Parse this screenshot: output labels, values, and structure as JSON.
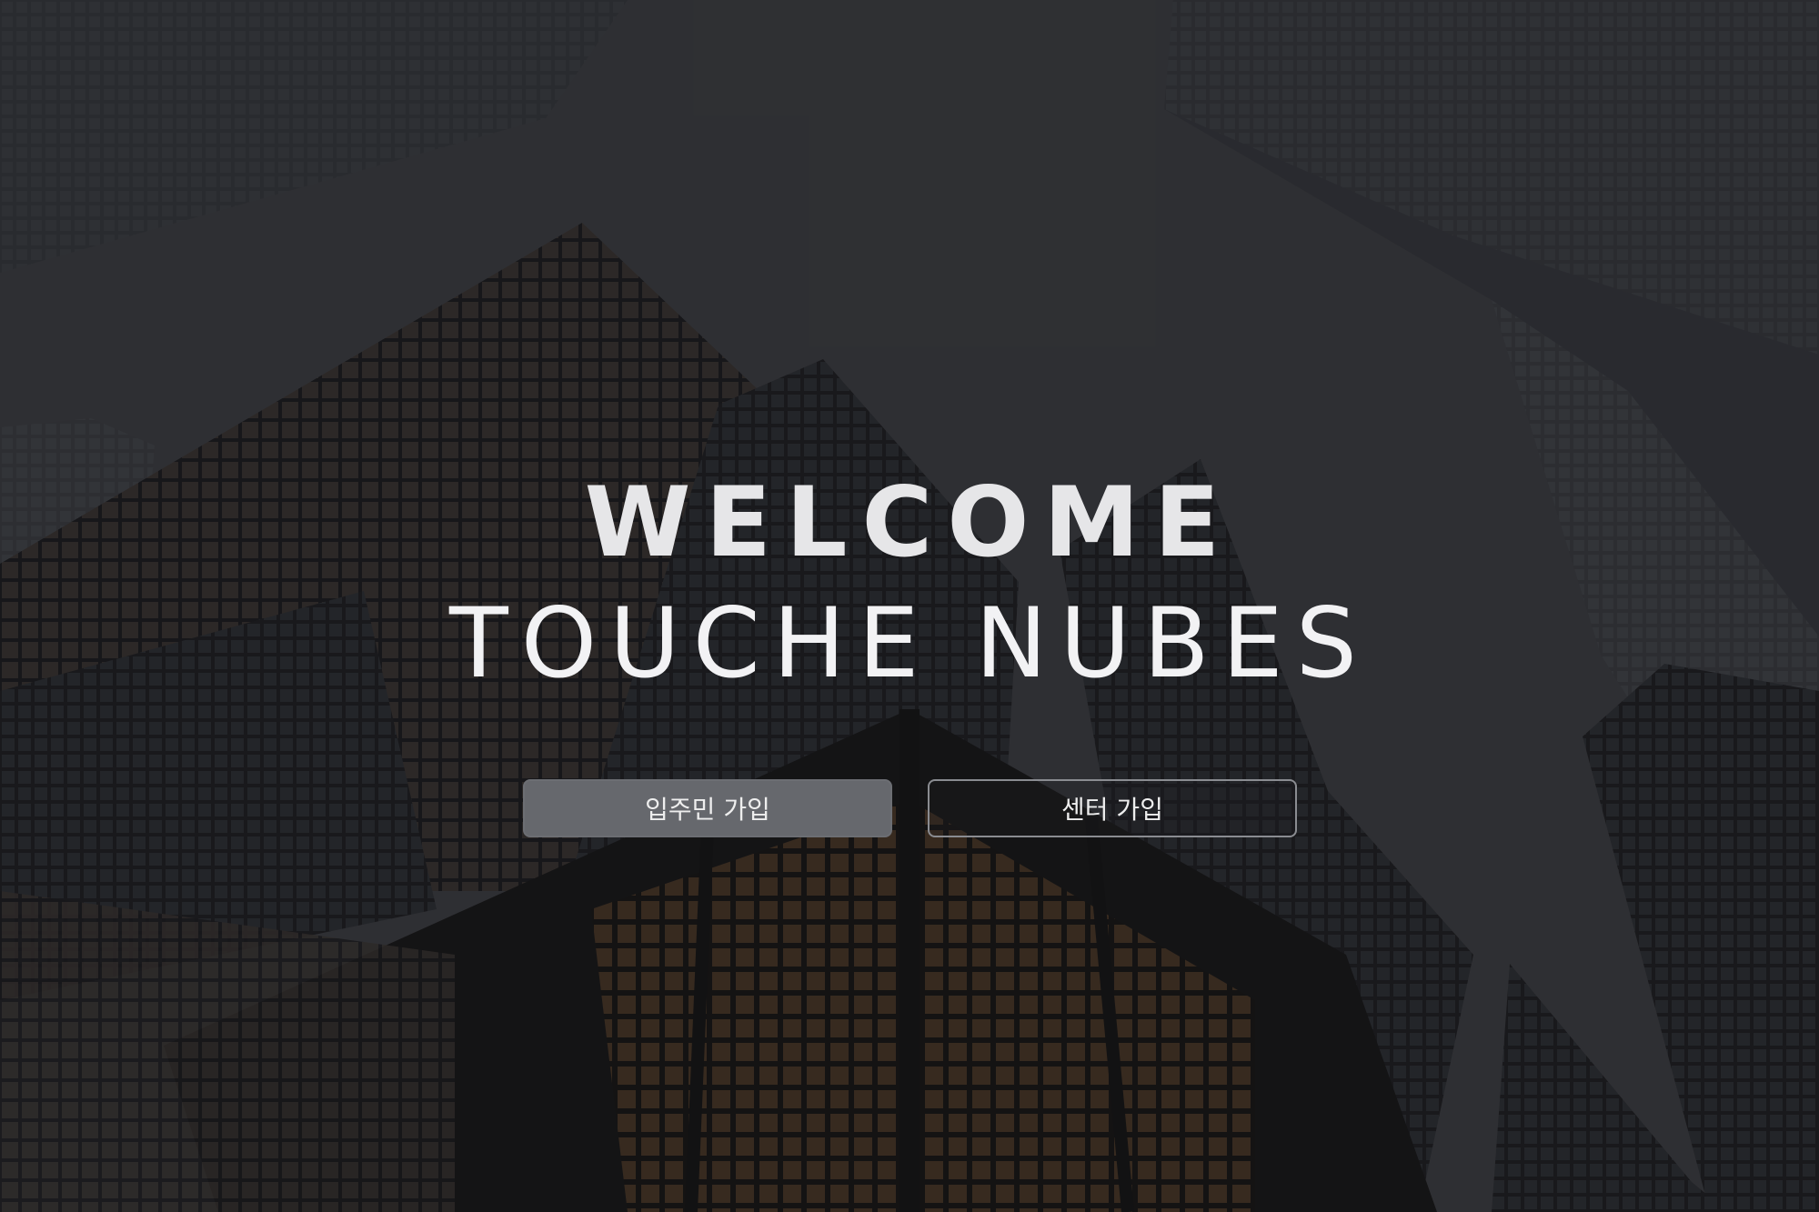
{
  "hero": {
    "heading": "WELCOME",
    "brand": "TOUCHE NUBES"
  },
  "actions": {
    "resident_signup_label": "입주민 가입",
    "center_signup_label": "센터 가입"
  },
  "colors": {
    "overlay": "#141518",
    "text": "#e6e6e8",
    "primary_button": "#66686d",
    "secondary_button_border": "#8a8c91"
  }
}
